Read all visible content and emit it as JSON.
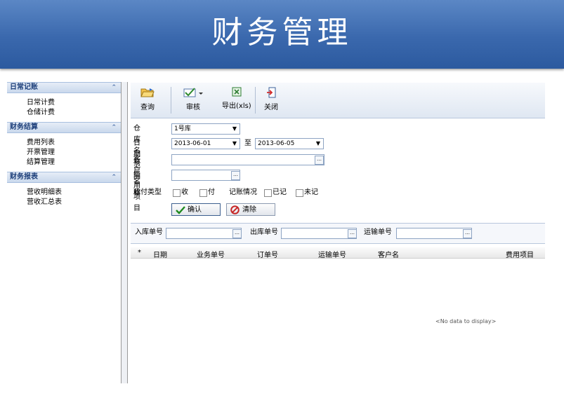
{
  "banner": {
    "title": "财务管理"
  },
  "sidebar": {
    "groups": [
      {
        "label": "日常记账",
        "items": [
          "日常计费",
          "仓储计费"
        ]
      },
      {
        "label": "财务结算",
        "items": [
          "费用列表",
          "开票管理",
          "结算管理"
        ]
      },
      {
        "label": "财务报表",
        "items": [
          "营收明细表",
          "营收汇总表"
        ]
      }
    ]
  },
  "toolbar": {
    "query": "查询",
    "review": "审核",
    "export": "导出(xls)",
    "close": "关闭"
  },
  "form": {
    "warehouse_label": "仓库名称",
    "warehouse_value": "1号库",
    "date_label": "日期范围",
    "date_from": "2013-06-01",
    "date_to_label": "至",
    "date_to": "2013-06-05",
    "customer_label": "客户名称",
    "fee_label": "费用项目",
    "pay_type_label": "收付类型",
    "receive": "收",
    "pay": "付",
    "record_label": "记账情况",
    "recorded": "已记",
    "unrecorded": "未记",
    "confirm": "确认",
    "clear": "清除"
  },
  "filter": {
    "inbound_label": "入库单号",
    "outbound_label": "出库单号",
    "transport_label": "运输单号"
  },
  "grid": {
    "columns": [
      "*",
      "日期",
      "业务单号",
      "订单号",
      "运输单号",
      "客户名",
      "费用项目"
    ],
    "empty": "<No data to display>"
  }
}
